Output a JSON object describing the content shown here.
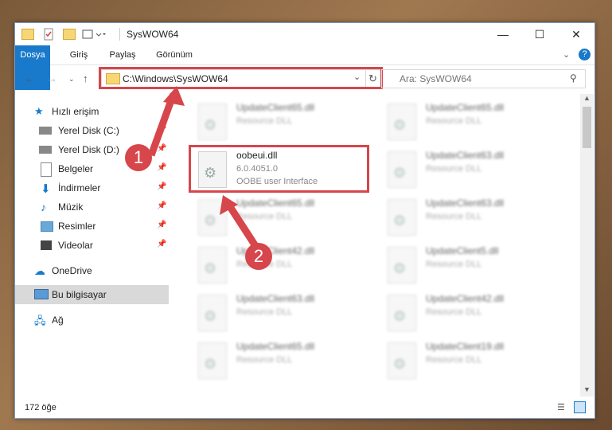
{
  "window": {
    "title": "SysWOW64"
  },
  "ribbon": {
    "tabs": [
      "Dosya",
      "Giriş",
      "Paylaş",
      "Görünüm"
    ]
  },
  "address": {
    "path": "C:\\Windows\\SysWOW64"
  },
  "search": {
    "placeholder": "Ara: SysWOW64"
  },
  "sidebar": {
    "items": [
      {
        "label": "Hızlı erişim"
      },
      {
        "label": "Yerel Disk (C:)"
      },
      {
        "label": "Yerel Disk (D:)"
      },
      {
        "label": "Belgeler"
      },
      {
        "label": "İndirmeler"
      },
      {
        "label": "Müzik"
      },
      {
        "label": "Resimler"
      },
      {
        "label": "Videolar"
      },
      {
        "label": "OneDrive"
      },
      {
        "label": "Bu bilgisayar"
      },
      {
        "label": "Ağ"
      }
    ]
  },
  "files": {
    "highlighted": {
      "name": "oobeui.dll",
      "version": "6.0.4051.0",
      "description": "OOBE user Interface"
    },
    "left": [
      {
        "name": "UpdateClient65.dll",
        "type": "Resource DLL"
      },
      {
        "name": "UpdateClient65.dll",
        "type": "Resource DLL"
      },
      {
        "name": "UpdateClient42.dll",
        "type": "Resource DLL"
      },
      {
        "name": "UpdateClient63.dll",
        "type": "Resource DLL"
      },
      {
        "name": "UpdateClient65.dll",
        "type": "Resource DLL"
      }
    ],
    "right": [
      {
        "name": "UpdateClient65.dll",
        "type": "Resource DLL"
      },
      {
        "name": "UpdateClient63.dll",
        "type": "Resource DLL"
      },
      {
        "name": "UpdateClient63.dll",
        "type": "Resource DLL"
      },
      {
        "name": "UpdateClient5.dll",
        "type": "Resource DLL"
      },
      {
        "name": "UpdateClient42.dll",
        "type": "Resource DLL"
      },
      {
        "name": "UpdateClient19.dll",
        "type": "Resource DLL"
      }
    ]
  },
  "status": {
    "count": "172 öğe"
  },
  "annotations": {
    "step1": "1",
    "step2": "2"
  },
  "colors": {
    "accent": "#1979ca",
    "highlight": "#d6464b"
  }
}
